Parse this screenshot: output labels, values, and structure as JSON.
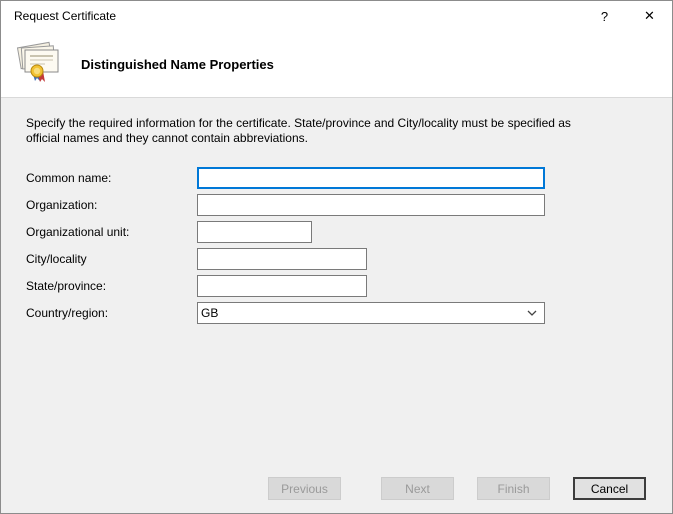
{
  "window": {
    "title": "Request Certificate",
    "help_glyph": "?",
    "close_glyph": "✕"
  },
  "header": {
    "title": "Distinguished Name Properties"
  },
  "main": {
    "instructions": "Specify the required information for the certificate. State/province and City/locality must be specified as official names and they cannot contain abbreviations.",
    "fields": [
      {
        "label": "Common name:",
        "value": ""
      },
      {
        "label": "Organization:",
        "value": ""
      },
      {
        "label": "Organizational unit:",
        "value": ""
      },
      {
        "label": "City/locality",
        "value": ""
      },
      {
        "label": "State/province:",
        "value": ""
      },
      {
        "label": "Country/region:",
        "value": "GB"
      }
    ]
  },
  "footer": {
    "previous_label": "Previous",
    "next_label": "Next",
    "finish_label": "Finish",
    "cancel_label": "Cancel"
  },
  "colors": {
    "focus_border": "#0078d7",
    "titlebar_bg": "#ffffff",
    "body_bg": "#f0f0f0"
  }
}
